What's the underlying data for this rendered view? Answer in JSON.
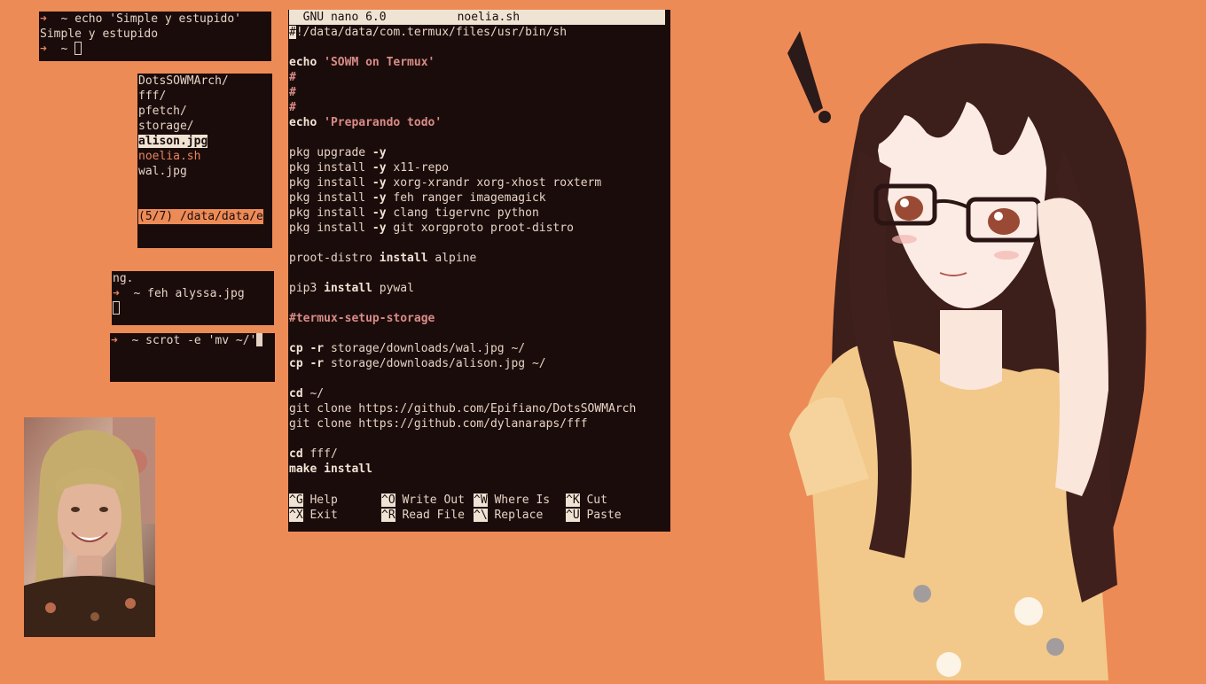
{
  "terminal_top": {
    "line1_prompt": "➜",
    "line1_cmd": "  ~ echo 'Simple y estupido'",
    "line2": "Simple y estupido",
    "line3_prompt": "➜",
    "line3_cmd": "  ~ "
  },
  "file_manager": {
    "entries": [
      "DotsSOWMArch/",
      "fff/",
      "pfetch/",
      "storage/",
      "alison.jpg",
      "noelia.sh",
      "wal.jpg"
    ],
    "status": "(5/7) /data/data/e"
  },
  "terminal_feh": {
    "line1": "ng.",
    "line2_prompt": "➜",
    "line2_cmd": "  ~ feh alyssa.jpg"
  },
  "terminal_scrot": {
    "prompt": "➜",
    "cmd": "  ~ scrot -e 'mv ~/'"
  },
  "nano": {
    "title_app": "  GNU nano 6.0",
    "title_file": "noelia.sh",
    "shebang_hash": "#",
    "shebang_rest": "!/data/data/com.termux/files/usr/bin/sh",
    "echo1_kw": "echo",
    "echo1_str": "'SOWM on Termux'",
    "comment": "#",
    "echo2_kw": "echo",
    "echo2_str": "'Preparando todo'",
    "pkg1": "pkg upgrade",
    "pkg_flag": "-y",
    "pkg_install": "pkg install",
    "pkg2_args": "x11-repo",
    "pkg3_args": "xorg-xrandr xorg-xhost roxterm",
    "pkg4_args": "feh ranger imagemagick",
    "pkg5_args": "clang tigervnc python",
    "pkg6_args": "git xorgproto proot-distro",
    "proot_pre": "proot-distro",
    "install_kw": "install",
    "proot_arg": "alpine",
    "pip_pre": "pip3",
    "pip_arg": "pywal",
    "setup_comment": "#termux-setup-storage",
    "cp_kw": "cp",
    "cp_flag": "-r",
    "cp1_args": "storage/downloads/wal.jpg ~/",
    "cp2_args": "storage/downloads/alison.jpg ~/",
    "cd_kw": "cd",
    "cd1_arg": "~/",
    "git1": "git clone https://github.com/Epifiano/DotsSOWMArch",
    "git2": "git clone https://github.com/dylanaraps/fff",
    "cd2_arg": "fff/",
    "make_kw": "make",
    "shortcuts": [
      {
        "key": "^G",
        "label": " Help"
      },
      {
        "key": "^O",
        "label": " Write Out"
      },
      {
        "key": "^W",
        "label": " Where Is"
      },
      {
        "key": "^K",
        "label": " Cut"
      },
      {
        "key": "^X",
        "label": " Exit"
      },
      {
        "key": "^R",
        "label": " Read File"
      },
      {
        "key": "^\\",
        "label": " Replace"
      },
      {
        "key": "^U",
        "label": " Paste"
      }
    ]
  },
  "colors": {
    "desktop_bg": "#ed8b57",
    "terminal_bg": "#1b0c0c",
    "terminal_fg": "#e6d3c4",
    "accent": "#e8845a",
    "string": "#d98c86"
  },
  "wallpaper": {
    "icon": "anime-girl-illustration",
    "exclamation_icon": "exclamation-mark-icon"
  },
  "photo": {
    "icon": "portrait-photo"
  }
}
